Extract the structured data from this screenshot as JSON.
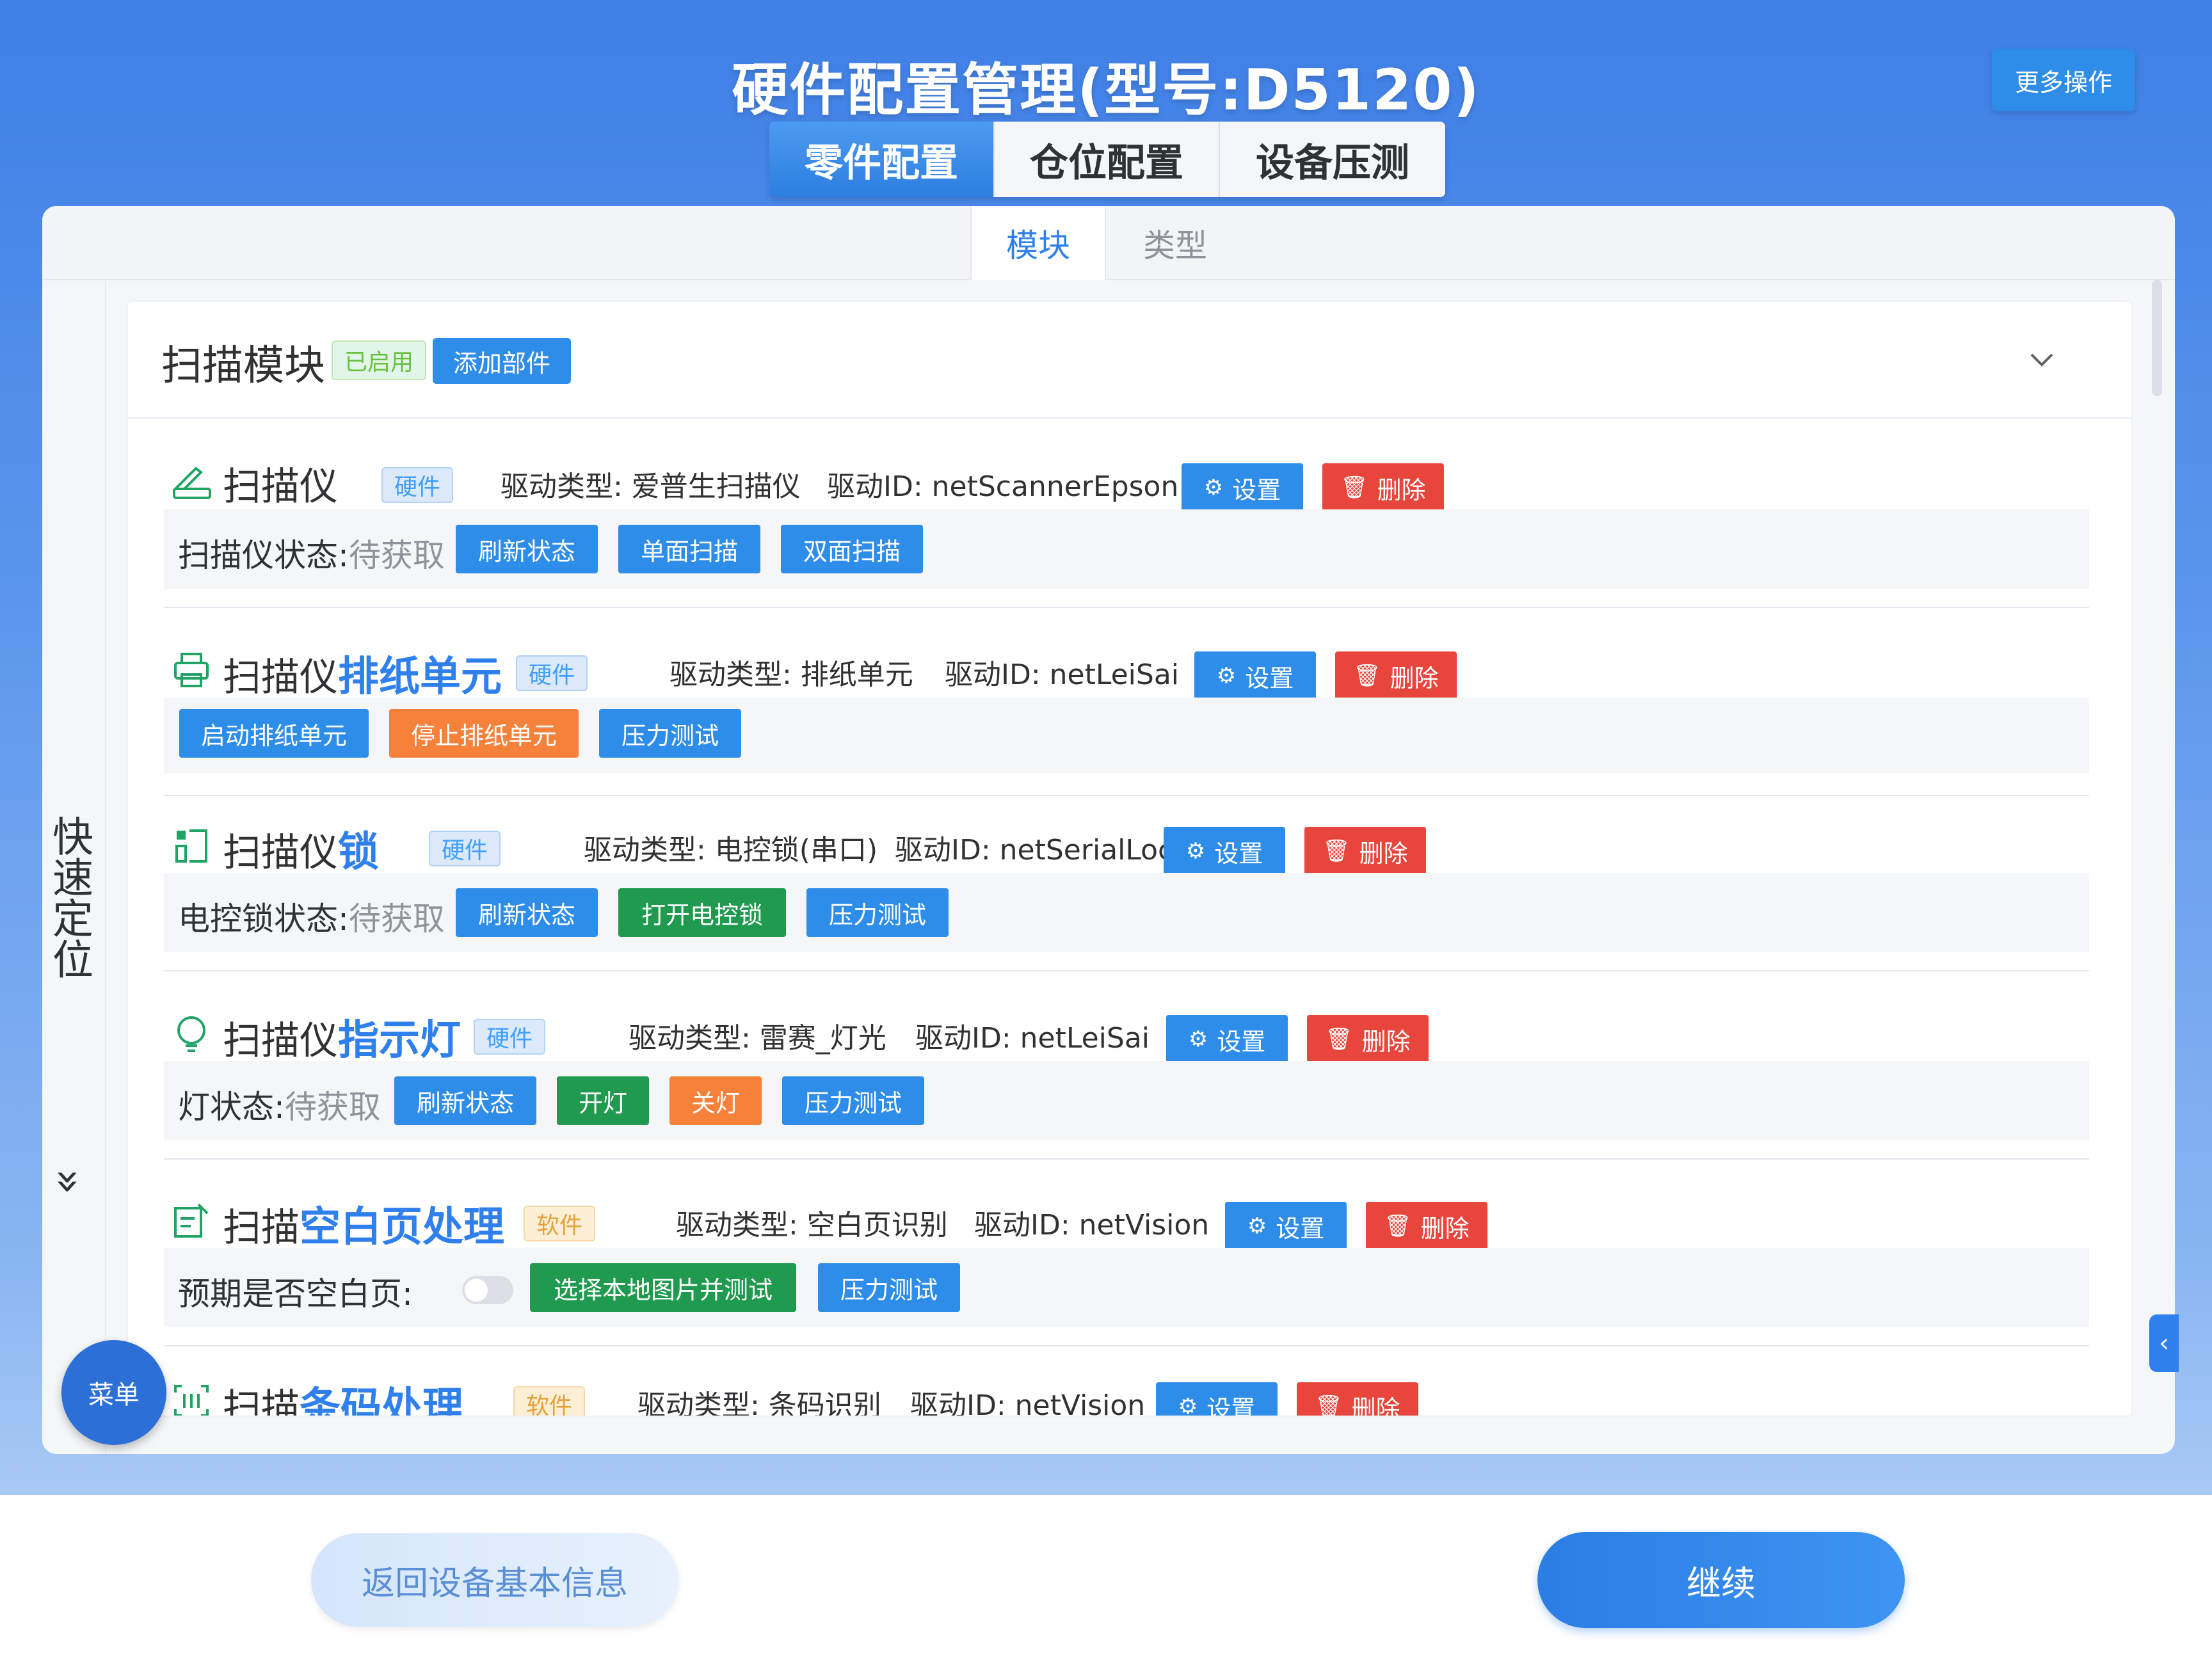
{
  "header": {
    "title": "硬件配置管理(型号:D5120)",
    "more_label": "更多操作",
    "tabs": [
      "零件配置",
      "仓位配置",
      "设备压测"
    ]
  },
  "sub_tabs": [
    "模块",
    "类型"
  ],
  "quick_locate": {
    "label": "快速定位",
    "arrow": "»"
  },
  "module": {
    "title": "扫描模块",
    "status": "已启用",
    "add_label": "添加部件"
  },
  "common": {
    "settings": "设置",
    "delete": "删除",
    "hardware": "硬件",
    "software": "软件",
    "refresh": "刷新状态",
    "stress": "压力测试",
    "pending": "待获取"
  },
  "items": [
    {
      "name_prefix": "扫描仪",
      "name_highlight": "",
      "driver_type": "驱动类型: 爱普生扫描仪",
      "driver_id": "驱动ID: netScannerEpson",
      "status_label": "扫描仪状态:",
      "actions": [
        "刷新状态",
        "单面扫描",
        "双面扫描"
      ]
    },
    {
      "name_prefix": "扫描仪",
      "name_highlight": "排纸单元",
      "driver_type": "驱动类型: 排纸单元",
      "driver_id": "驱动ID: netLeiSai",
      "actions": [
        "启动排纸单元",
        "停止排纸单元",
        "压力测试"
      ]
    },
    {
      "name_prefix": "扫描仪",
      "name_highlight": "锁",
      "driver_type": "驱动类型: 电控锁(串口)",
      "driver_id": "驱动ID: netSerialLock",
      "status_label": "电控锁状态:",
      "actions": [
        "刷新状态",
        "打开电控锁",
        "压力测试"
      ]
    },
    {
      "name_prefix": "扫描仪",
      "name_highlight": "指示灯",
      "driver_type": "驱动类型: 雷赛_灯光",
      "driver_id": "驱动ID: netLeiSai",
      "status_label": "灯状态:",
      "actions": [
        "刷新状态",
        "开灯",
        "关灯",
        "压力测试"
      ]
    },
    {
      "name_prefix": "扫描",
      "name_highlight": "空白页处理",
      "driver_type": "驱动类型: 空白页识别",
      "driver_id": "驱动ID: netVision",
      "status_label": "预期是否空白页:",
      "actions": [
        "选择本地图片并测试",
        "压力测试"
      ]
    },
    {
      "name_prefix": "扫描",
      "name_highlight": "条码处理",
      "driver_type": "驱动类型: 条码识别",
      "driver_id": "驱动ID: netVision"
    }
  ],
  "menu_label": "菜单",
  "footer": {
    "back_label": "返回设备基本信息",
    "next_label": "继续"
  },
  "colors": {
    "primary": "#2e8de8",
    "danger": "#e8453c",
    "success": "#1f9a4e",
    "warning": "#f5813a"
  }
}
